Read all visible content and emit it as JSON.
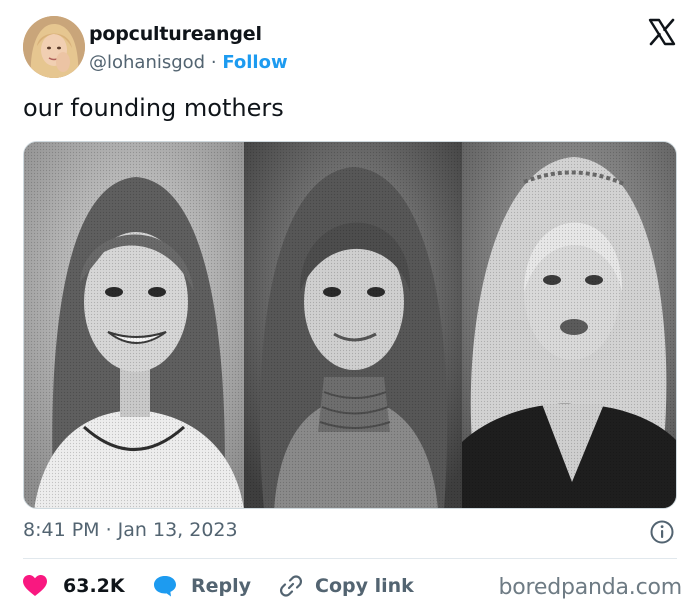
{
  "user": {
    "display_name": "popcultureangel",
    "handle": "@lohanisgod",
    "separator": "·",
    "follow_label": "Follow"
  },
  "tweet": {
    "text": "our founding mothers",
    "timestamp": "8:41 PM · Jan 13, 2023"
  },
  "actions": {
    "like_count": "63.2K",
    "reply_label": "Reply",
    "copy_label": "Copy link"
  },
  "watermark": "boredpanda.com",
  "icons": {
    "brand": "x-logo-icon",
    "info": "info-icon",
    "like": "heart-icon",
    "reply": "speech-bubble-icon",
    "copy": "link-icon"
  },
  "colors": {
    "accent": "#1d9bf0",
    "like": "#f91880",
    "muted": "#536471",
    "text": "#0f1419"
  }
}
